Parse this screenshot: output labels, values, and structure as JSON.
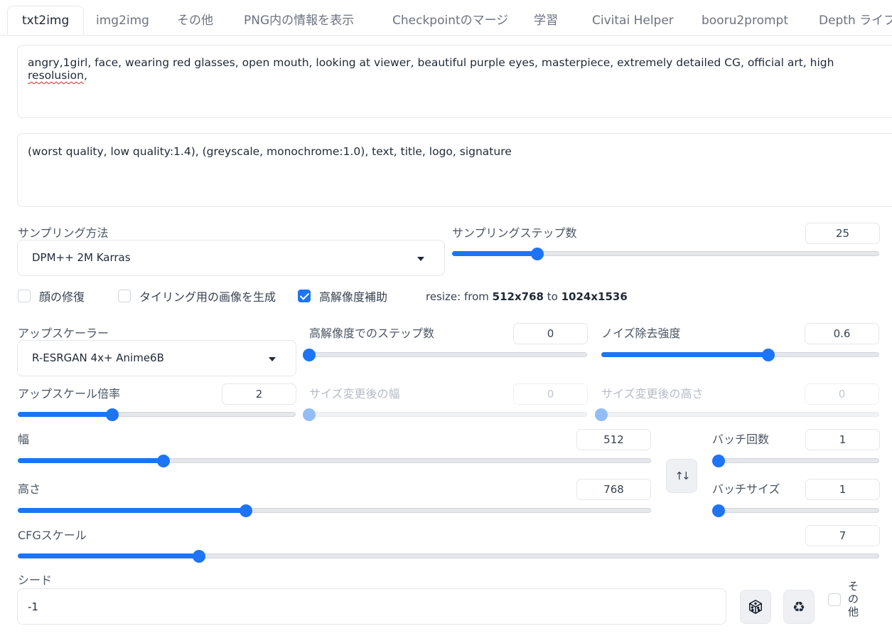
{
  "tabs": [
    "txt2img",
    "img2img",
    "その他",
    "PNG内の情報を表示",
    "Checkpointのマージ",
    "学習",
    "Civitai Helper",
    "booru2prompt",
    "Depth ライブラ"
  ],
  "prompt": {
    "before": "angry,1girl, face, wearing red glasses, open mouth, looking at viewer, beautiful purple eyes, masterpiece, extremely detailed CG, official art, high ",
    "misspelled": "resolusion",
    "after": ","
  },
  "negative_prompt": "(worst quality, low quality:1.4), (greyscale, monochrome:1.0), text, title, logo, signature",
  "sampler": {
    "label": "サンプリング方法",
    "value": "DPM++ 2M Karras"
  },
  "steps": {
    "label": "サンプリングステップ数",
    "value": "25",
    "fraction": 0.2
  },
  "checkboxes": {
    "face_restore": {
      "label": "顔の修復",
      "checked": false
    },
    "tiling": {
      "label": "タイリング用の画像を生成",
      "checked": false
    },
    "hires": {
      "label": "高解像度補助",
      "checked": true
    }
  },
  "resize_info": {
    "prefix": "resize: from ",
    "from": "512x768",
    "mid": " to ",
    "to": "1024x1536"
  },
  "upscaler": {
    "label": "アップスケーラー",
    "value": "R-ESRGAN 4x+ Anime6B"
  },
  "hires_steps": {
    "label": "高解像度でのステップ数",
    "value": "0",
    "fraction": 0.0
  },
  "denoise": {
    "label": "ノイズ除去強度",
    "value": "0.6",
    "fraction": 0.6
  },
  "upscale_by": {
    "label": "アップスケール倍率",
    "value": "2",
    "fraction": 0.34
  },
  "resize_width": {
    "label": "サイズ変更後の幅",
    "value": "0",
    "fraction": 0.0
  },
  "resize_height": {
    "label": "サイズ変更後の高さ",
    "value": "0",
    "fraction": 0.0
  },
  "width": {
    "label": "幅",
    "value": "512",
    "fraction": 0.23
  },
  "height": {
    "label": "高さ",
    "value": "768",
    "fraction": 0.36
  },
  "batch_count": {
    "label": "バッチ回数",
    "value": "1",
    "fraction": 0.0
  },
  "batch_size": {
    "label": "バッチサイズ",
    "value": "1",
    "fraction": 0.0
  },
  "cfg": {
    "label": "CFGスケール",
    "value": "7",
    "fraction": 0.21
  },
  "seed": {
    "label": "シード",
    "value": "-1",
    "extra_label": "その他"
  },
  "icons": {
    "swap": "swap-icon",
    "dice": "dice-icon",
    "recycle": "recycle-icon"
  },
  "colors": {
    "accent": "#1d74f5",
    "border": "#e5e7eb"
  }
}
